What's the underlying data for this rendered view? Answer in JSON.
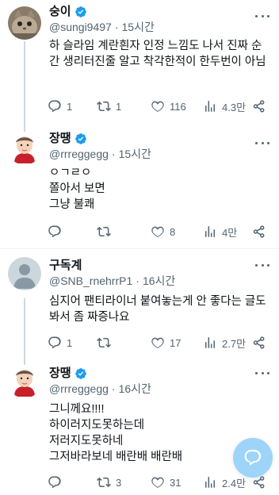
{
  "colors": {
    "accent": "#1d9bf0",
    "muted": "#536471",
    "text": "#0f1419",
    "divider": "#eff3f4"
  },
  "tweets": [
    {
      "name": "숭이",
      "handle": "@sungi9497",
      "time": "15시간",
      "text": "하 슬라임 계란흰자 인정 느낌도 나서 진짜 순간 생리터진줄 알고 착각한적이 한두번이 아님",
      "replies": "1",
      "retweets": "1",
      "likes": "116",
      "views": "4.3만",
      "avatar_icon": "cat-photo-avatar"
    },
    {
      "name": "장땡",
      "handle": "@rrreggegg",
      "time": "15시간",
      "text": "ㅇㄱㄹㅇ\n쫄아서 보면\n그냥 불쾌",
      "replies": "",
      "retweets": "",
      "likes": "8",
      "views": "4만",
      "avatar_icon": "cartoon-person-avatar"
    },
    {
      "name": "구독계",
      "handle": "@SNB_rnehrrP1",
      "time": "16시간",
      "text": "심지어 팬티라이너 붙여놓는게 안 좋다는 글도 봐서 좀 짜증나요",
      "replies": "1",
      "retweets": "",
      "likes": "17",
      "views": "2.7만",
      "avatar_icon": "default-person-avatar"
    },
    {
      "name": "장땡",
      "handle": "@rrreggegg",
      "time": "16시간",
      "text": "그니께요!!!!\n하이러지도못하는데\n저러지도못하네\n그저바라보네 배란배 배란배",
      "replies": "",
      "retweets": "3",
      "likes": "31",
      "views": "2.4만",
      "avatar_icon": "cartoon-person-avatar"
    }
  ],
  "dot": "·",
  "fab_icon": "compose-reply-icon"
}
